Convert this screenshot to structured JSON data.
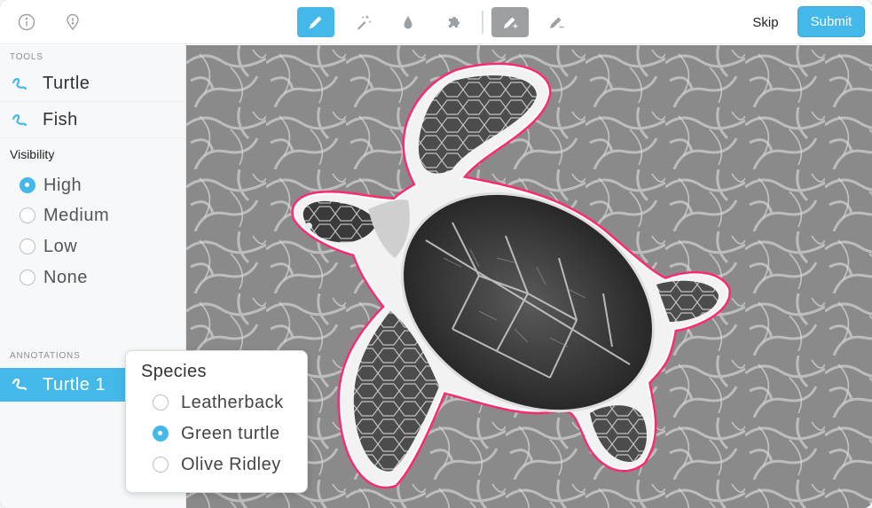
{
  "toolbar": {
    "left_icons": [
      "info-icon",
      "location-pin-icon"
    ],
    "center_tools": [
      "pencil-icon",
      "magic-wand-icon",
      "drop-icon",
      "puzzle-icon",
      "pencil-add-icon",
      "pencil-remove-icon"
    ],
    "active_tool": "pencil-icon",
    "skip_label": "Skip",
    "submit_label": "Submit"
  },
  "sidebar": {
    "tools_label": "TOOLS",
    "tools": [
      {
        "label": "Turtle",
        "icon": "polygon-icon"
      },
      {
        "label": "Fish",
        "icon": "polygon-icon"
      }
    ],
    "visibility": {
      "title": "Visibility",
      "options": [
        "High",
        "Medium",
        "Low",
        "None"
      ],
      "selected": "High"
    },
    "annotations_label": "ANNOTATIONS",
    "annotations": [
      {
        "label": "Turtle 1",
        "icon": "polygon-icon"
      }
    ]
  },
  "species_popup": {
    "title": "Species",
    "options": [
      "Leatherback",
      "Green turtle",
      "Olive Ridley"
    ],
    "selected": "Green turtle"
  },
  "colors": {
    "accent": "#45b8ea",
    "annotation_outline": "#ff2a6d"
  }
}
